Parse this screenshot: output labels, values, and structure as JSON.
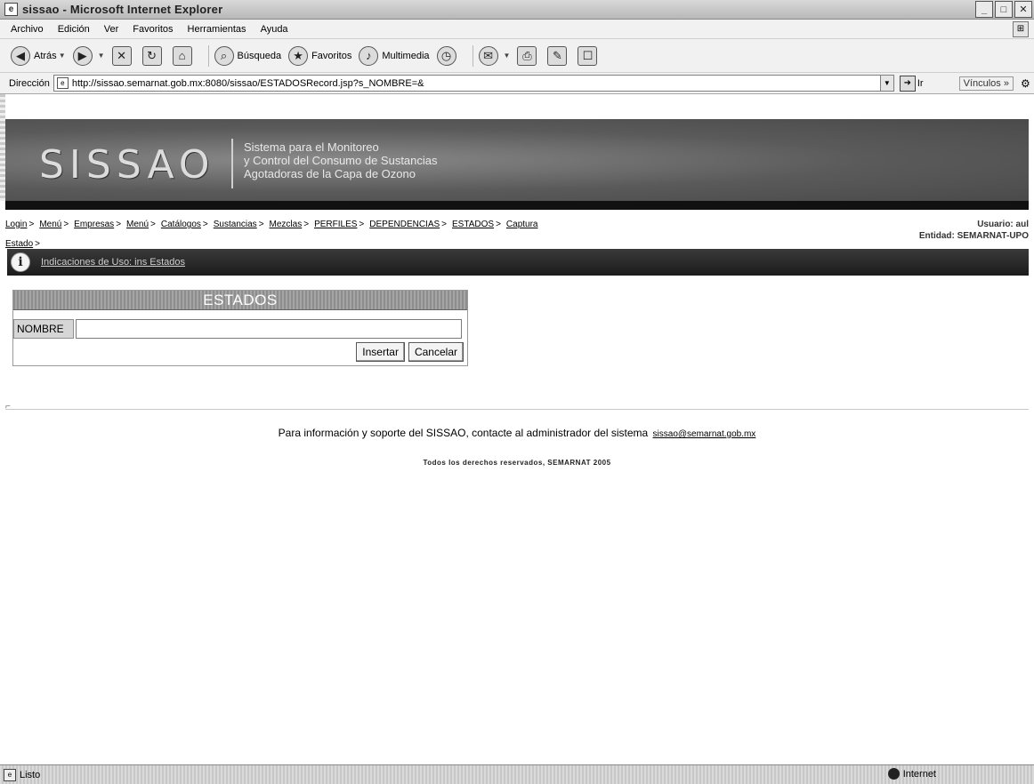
{
  "window": {
    "title": "sissao - Microsoft Internet Explorer",
    "buttons": [
      "_",
      "□",
      "✕"
    ]
  },
  "menu": {
    "items": [
      "Archivo",
      "Edición",
      "Ver",
      "Favoritos",
      "Herramientas",
      "Ayuda"
    ]
  },
  "toolbar": {
    "back_label": "Atrás",
    "search_label": "Búsqueda",
    "favorites_label": "Favoritos",
    "multimedia_label": "Multimedia"
  },
  "address": {
    "label": "Dirección",
    "url": "http://sissao.semarnat.gob.mx:8080/sissao/ESTADOSRecord.jsp?s_NOMBRE=&",
    "go_label": "Ir",
    "links_label": "Vínculos"
  },
  "banner": {
    "logo": "SISSAO",
    "tagline": [
      "Sistema para el Monitoreo",
      "y Control del Consumo de Sustancias",
      "Agotadoras de la Capa de Ozono"
    ]
  },
  "breadcrumb": {
    "items": [
      "Login",
      "Menú",
      "Empresas",
      "Menú",
      "Catálogos",
      "Sustancias",
      "Mezclas",
      "PERFILES",
      "DEPENDENCIAS",
      "ESTADOS",
      "Captura"
    ],
    "last": "Estado"
  },
  "user": {
    "usuario": "Usuario: aul",
    "entidad": "Entidad: SEMARNAT-UPO"
  },
  "info_bar": {
    "text": "Indicaciones de Uso: ins Estados"
  },
  "form": {
    "title": "ESTADOS",
    "field_label": "NOMBRE",
    "field_value": "",
    "insert_label": "Insertar",
    "cancel_label": "Cancelar"
  },
  "footer": {
    "support_text": "Para información y soporte del SISSAO, contacte al administrador del sistema",
    "support_email": "sissao@semarnat.gob.mx",
    "rights": "Todos los derechos reservados, SEMARNAT 2005"
  },
  "status": {
    "text": "Listo",
    "zone": "Internet"
  }
}
